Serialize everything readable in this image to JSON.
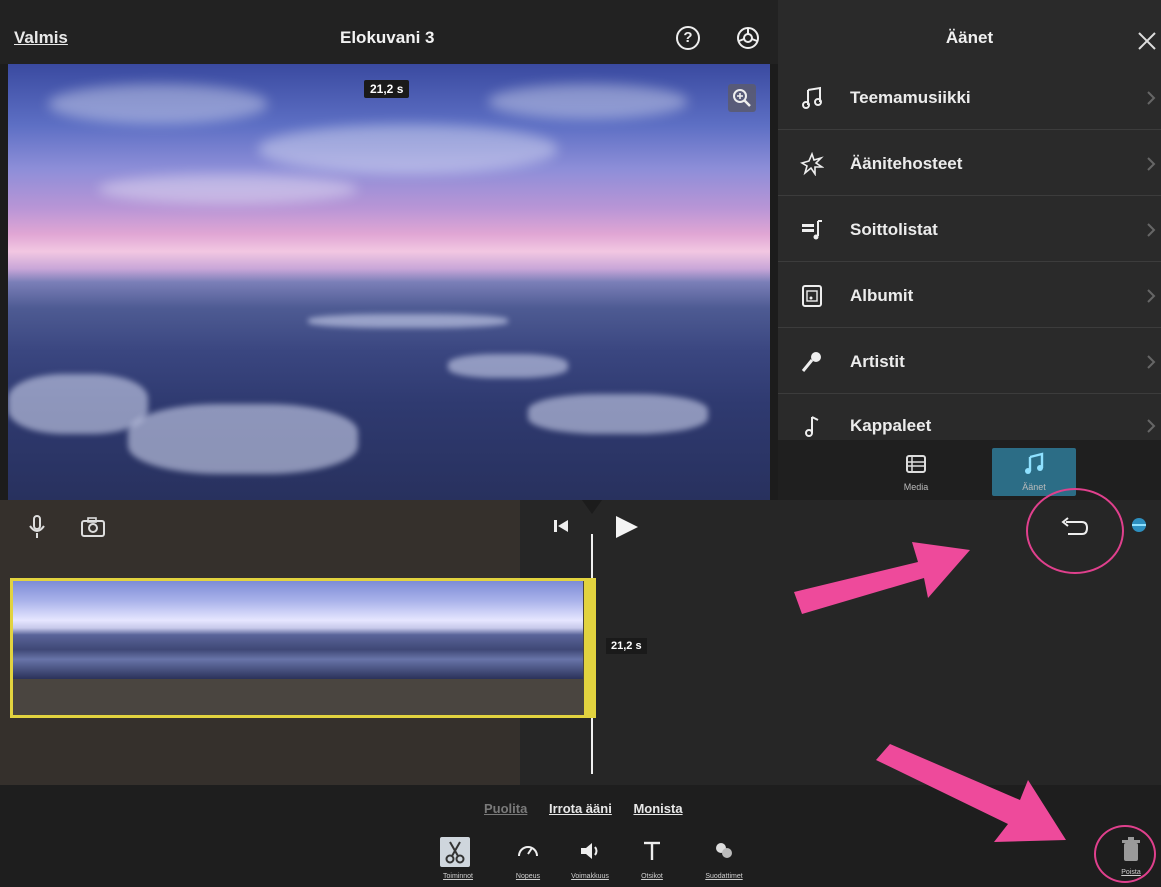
{
  "topbar": {
    "done_label": "Valmis",
    "title": "Elokuvani 3",
    "help_symbol": "?"
  },
  "preview": {
    "duration_badge": "21,2 s"
  },
  "audio_panel": {
    "title": "Äänet",
    "items": [
      {
        "label": "Teemamusiikki",
        "icon": "music-note-icon"
      },
      {
        "label": "Äänitehosteet",
        "icon": "sound-effects-icon"
      },
      {
        "label": "Soittolistat",
        "icon": "playlist-icon"
      },
      {
        "label": "Albumit",
        "icon": "album-icon"
      },
      {
        "label": "Artistit",
        "icon": "microphone-icon"
      },
      {
        "label": "Kappaleet",
        "icon": "song-note-icon"
      }
    ],
    "tabs": [
      {
        "label": "Media",
        "icon": "film-icon",
        "active": false
      },
      {
        "label": "Äänet",
        "icon": "music-note-icon",
        "active": true
      }
    ]
  },
  "timeline": {
    "clip_duration": "21,2 s"
  },
  "bottombar": {
    "actions": [
      {
        "label": "Puolita",
        "enabled": false
      },
      {
        "label": "Irrota ääni",
        "enabled": true
      },
      {
        "label": "Monista",
        "enabled": true
      }
    ],
    "tools": [
      {
        "label": "Toiminnot",
        "icon": "scissors-icon",
        "active": true
      },
      {
        "label": "Nopeus",
        "icon": "speedometer-icon",
        "active": false
      },
      {
        "label": "Voimakkuus",
        "icon": "volume-icon",
        "active": false
      },
      {
        "label": "Otsikot",
        "icon": "text-icon",
        "active": false
      },
      {
        "label": "Suodattimet",
        "icon": "filters-icon",
        "active": false
      }
    ],
    "delete_label": "Poista"
  },
  "colors": {
    "accent_tab": "#2c6d86",
    "clip_border": "#e2d33f",
    "annotation": "#e0408d"
  }
}
